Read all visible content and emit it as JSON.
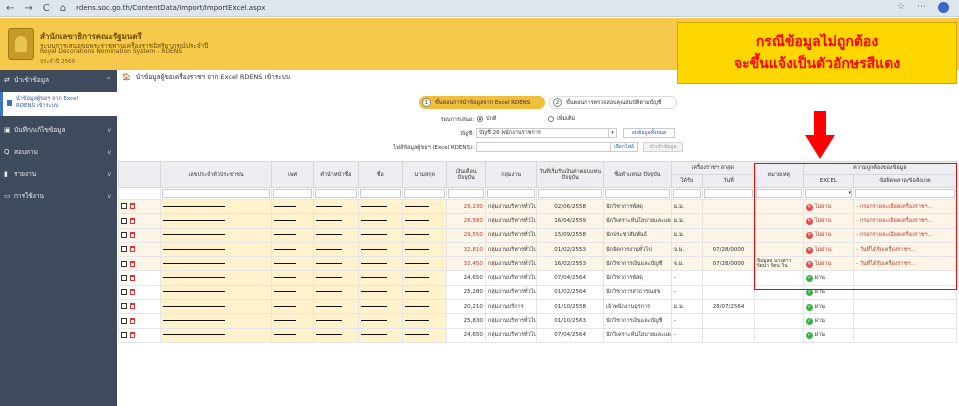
{
  "browser": {
    "back": "←",
    "forward": "→",
    "refresh": "C",
    "home": "⌂",
    "url": "rdens.soc.go.th/ContentData/Import/ImportExcel.aspx"
  },
  "header": {
    "line1": "สำนักเลขาธิการคณะรัฐมนตรี",
    "line2": "ระบบการเสนอขอพระราชทานเครื่องราชอิสริยาภรณ์ประจำปี",
    "line3": "Royal Decorations Nomination System - RDENS",
    "line4": "ประจำปี 2569"
  },
  "callout": {
    "line1": "กรณีข้อมูลไม่ถูกต้อง",
    "line2": "จะขึ้นแจ้งเป็นตัวอักษรสีแดง"
  },
  "sidebar": {
    "items": [
      {
        "icon": "⇄",
        "label": "นำเข้าข้อมูล"
      },
      {
        "icon": "▣",
        "label": "บันทึก/แก้ไขข้อมูล"
      },
      {
        "icon": "Q",
        "label": "สอบถาม"
      },
      {
        "icon": "▮",
        "label": "รายงาน"
      },
      {
        "icon": "▭",
        "label": "การใช้งาน"
      }
    ],
    "sub_line1": "นำข้อมูลผู้ขอฯ จาก Excel",
    "sub_line2": "RDENS เข้าระบบ"
  },
  "breadcrumb": "นำข้อมูลผู้ขอเครื่องราชฯ จาก Excel RDENS เข้าระบบ",
  "steps": [
    {
      "num": "1",
      "label": "ขั้นตอนการนำข้อมูลจาก Excel RDENS"
    },
    {
      "num": "2",
      "label": "ขั้นตอนการตรวจสอบคุณสมบัติตามบัญชี"
    }
  ],
  "form": {
    "mode_label": "รอบการเสนอ:",
    "mode_normal": "ปกติ",
    "mode_extra": "เพิ่มเติม",
    "account_label": "บัญชี:",
    "account_value": "บัญชี 26 พนักงานราชการ",
    "delete_all": "ลบข้อมูลทั้งหมด",
    "file_label": "ไฟล์ข้อมูลผู้ขอฯ (Excel RDENS):",
    "choose_file": "เลือกไฟล์",
    "import_button": "นำเข้าข้อมูล"
  },
  "table": {
    "headers": {
      "id": "เลขประจำตัวประชาชน",
      "gender": "เพศ",
      "title": "คำนำหน้าชื่อ",
      "name": "ชื่อ",
      "surname": "นามสกุล",
      "salary": "เงินเดือน ปัจจุบัน",
      "group": "กลุ่มงาน",
      "start_date": "วันที่เริ่มรับเงินค่าตอบแทน ปัจจุบัน",
      "position": "ชื่อตำแหน่ง ปัจจุบัน",
      "decor_group": "เครื่องราชฯ ล่าสุด",
      "decor_type": "ได้รับ",
      "decor_date": "วันที่",
      "note": "หมายเหตุ",
      "validity_group": "ความถูกต้องของข้อมูล",
      "excel": "EXCEL",
      "detail": "ข้อผิดพลาด/ข้อสังเกต"
    },
    "rows": [
      {
        "salary": "29,230",
        "group": "กลุ่มงานบริหารทั่วไป",
        "start": "02/06/2558",
        "position": "นักวิชาการพัสดุ",
        "decor": "ม.ม.",
        "decor_date": "",
        "note": "",
        "status": "ไม่ผ่าน",
        "detail": "- กรอกรายละเอียดเครื่องราชฯ...",
        "ok": false
      },
      {
        "salary": "28,580",
        "group": "กลุ่มงานบริหารทั่วไป",
        "start": "16/04/2559",
        "position": "นักวิเคราะห์นโยบายและแผน",
        "decor": "ม.ม.",
        "decor_date": "",
        "note": "",
        "status": "ไม่ผ่าน",
        "detail": "- กรอกรายละเอียดเครื่องราชฯ...",
        "ok": false
      },
      {
        "salary": "29,550",
        "group": "กลุ่มงานบริหารทั่วไป",
        "start": "15/09/2558",
        "position": "นักประชาสัมพันธ์",
        "decor": "ม.ม.",
        "decor_date": "",
        "note": "",
        "status": "ไม่ผ่าน",
        "detail": "- กรอกรายละเอียดเครื่องราชฯ...",
        "ok": false
      },
      {
        "salary": "32,810",
        "group": "กลุ่มงานบริหารทั่วไป",
        "start": "01/02/2553",
        "position": "นักจัดการงานทั่วไป",
        "decor": "จ.ม.",
        "decor_date": "07/28/0000",
        "note": "",
        "status": "ไม่ผ่าน",
        "detail": "- วันที่ได้รับเครื่องราชฯ...",
        "ok": false
      },
      {
        "salary": "32,450",
        "group": "กลุ่มงานบริหารทั่วไป",
        "start": "16/02/2553",
        "position": "นักวิชาการเงินและบัญชี",
        "decor": "จ.ม.",
        "decor_date": "07/28/0000",
        "note": "ข้อมูลจ นางสาวรัตนา รัตน วิน",
        "status": "ไม่ผ่าน",
        "detail": "- วันที่ได้รับเครื่องราชฯ...",
        "ok": false
      },
      {
        "salary": "24,650",
        "group": "กลุ่มงานบริหารทั่วไป",
        "start": "07/04/2564",
        "position": "นักวิชาการพัสดุ",
        "decor": "-",
        "decor_date": "",
        "note": "",
        "status": "ผ่าน",
        "detail": "",
        "ok": true
      },
      {
        "salary": "25,280",
        "group": "กลุ่มงานบริหารทั่วไป",
        "start": "01/02/2564",
        "position": "นักวิชาการสาธารณสุข",
        "decor": "-",
        "decor_date": "",
        "note": "",
        "status": "ผ่าน",
        "detail": "",
        "ok": true
      },
      {
        "salary": "20,210",
        "group": "กลุ่มงานบริการ",
        "start": "01/10/2558",
        "position": "เจ้าพนักงานธุรการ",
        "decor": "ม.ม.",
        "decor_date": "28/07/2564",
        "note": "",
        "status": "ผ่าน",
        "detail": "",
        "ok": true
      },
      {
        "salary": "25,830",
        "group": "กลุ่มงานบริหารทั่วไป",
        "start": "01/10/2563",
        "position": "นักวิชาการเงินและบัญชี",
        "decor": "-",
        "decor_date": "",
        "note": "",
        "status": "ผ่าน",
        "detail": "",
        "ok": true
      },
      {
        "salary": "24,650",
        "group": "กลุ่มงานบริหารทั่วไป",
        "start": "07/04/2564",
        "position": "นักวิเคราะห์นโยบายและแผน",
        "decor": "-",
        "decor_date": "",
        "note": "",
        "status": "ผ่าน",
        "detail": "",
        "ok": true
      }
    ]
  },
  "colors": {
    "header_bg": "#f6c94b",
    "sidebar_bg": "#3e4b5c",
    "callout_bg": "#ffd700",
    "callout_text": "#ff0000",
    "error": "#c0392b",
    "ok": "#3bb24a"
  }
}
